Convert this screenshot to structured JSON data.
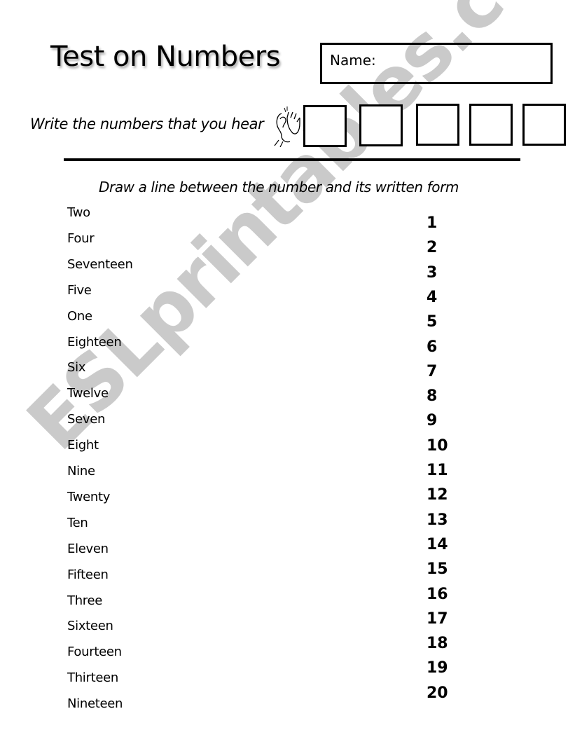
{
  "worksheet": {
    "title": "Test on Numbers",
    "name_label": "Name:",
    "listening_instruction": "Write the numbers that you hear",
    "listening_icon": "ear-hand-icon",
    "answer_box_count": 5,
    "matching_instruction": "Draw a line between the number and its written form",
    "words": [
      "Two",
      "Four",
      "Seventeen",
      "Five",
      "One",
      "Eighteen",
      "Six",
      "Twelve",
      "Seven",
      "Eight",
      "Nine",
      "Twenty",
      "Ten",
      "Eleven",
      "Fifteen",
      "Three",
      "Sixteen",
      "Fourteen",
      "Thirteen",
      "Nineteen"
    ],
    "numbers": [
      "1",
      "2",
      "3",
      "4",
      "5",
      "6",
      "7",
      "8",
      "9",
      "10",
      "11",
      "12",
      "13",
      "14",
      "15",
      "16",
      "17",
      "18",
      "19",
      "20"
    ],
    "watermark": "ESLprintables.com"
  }
}
